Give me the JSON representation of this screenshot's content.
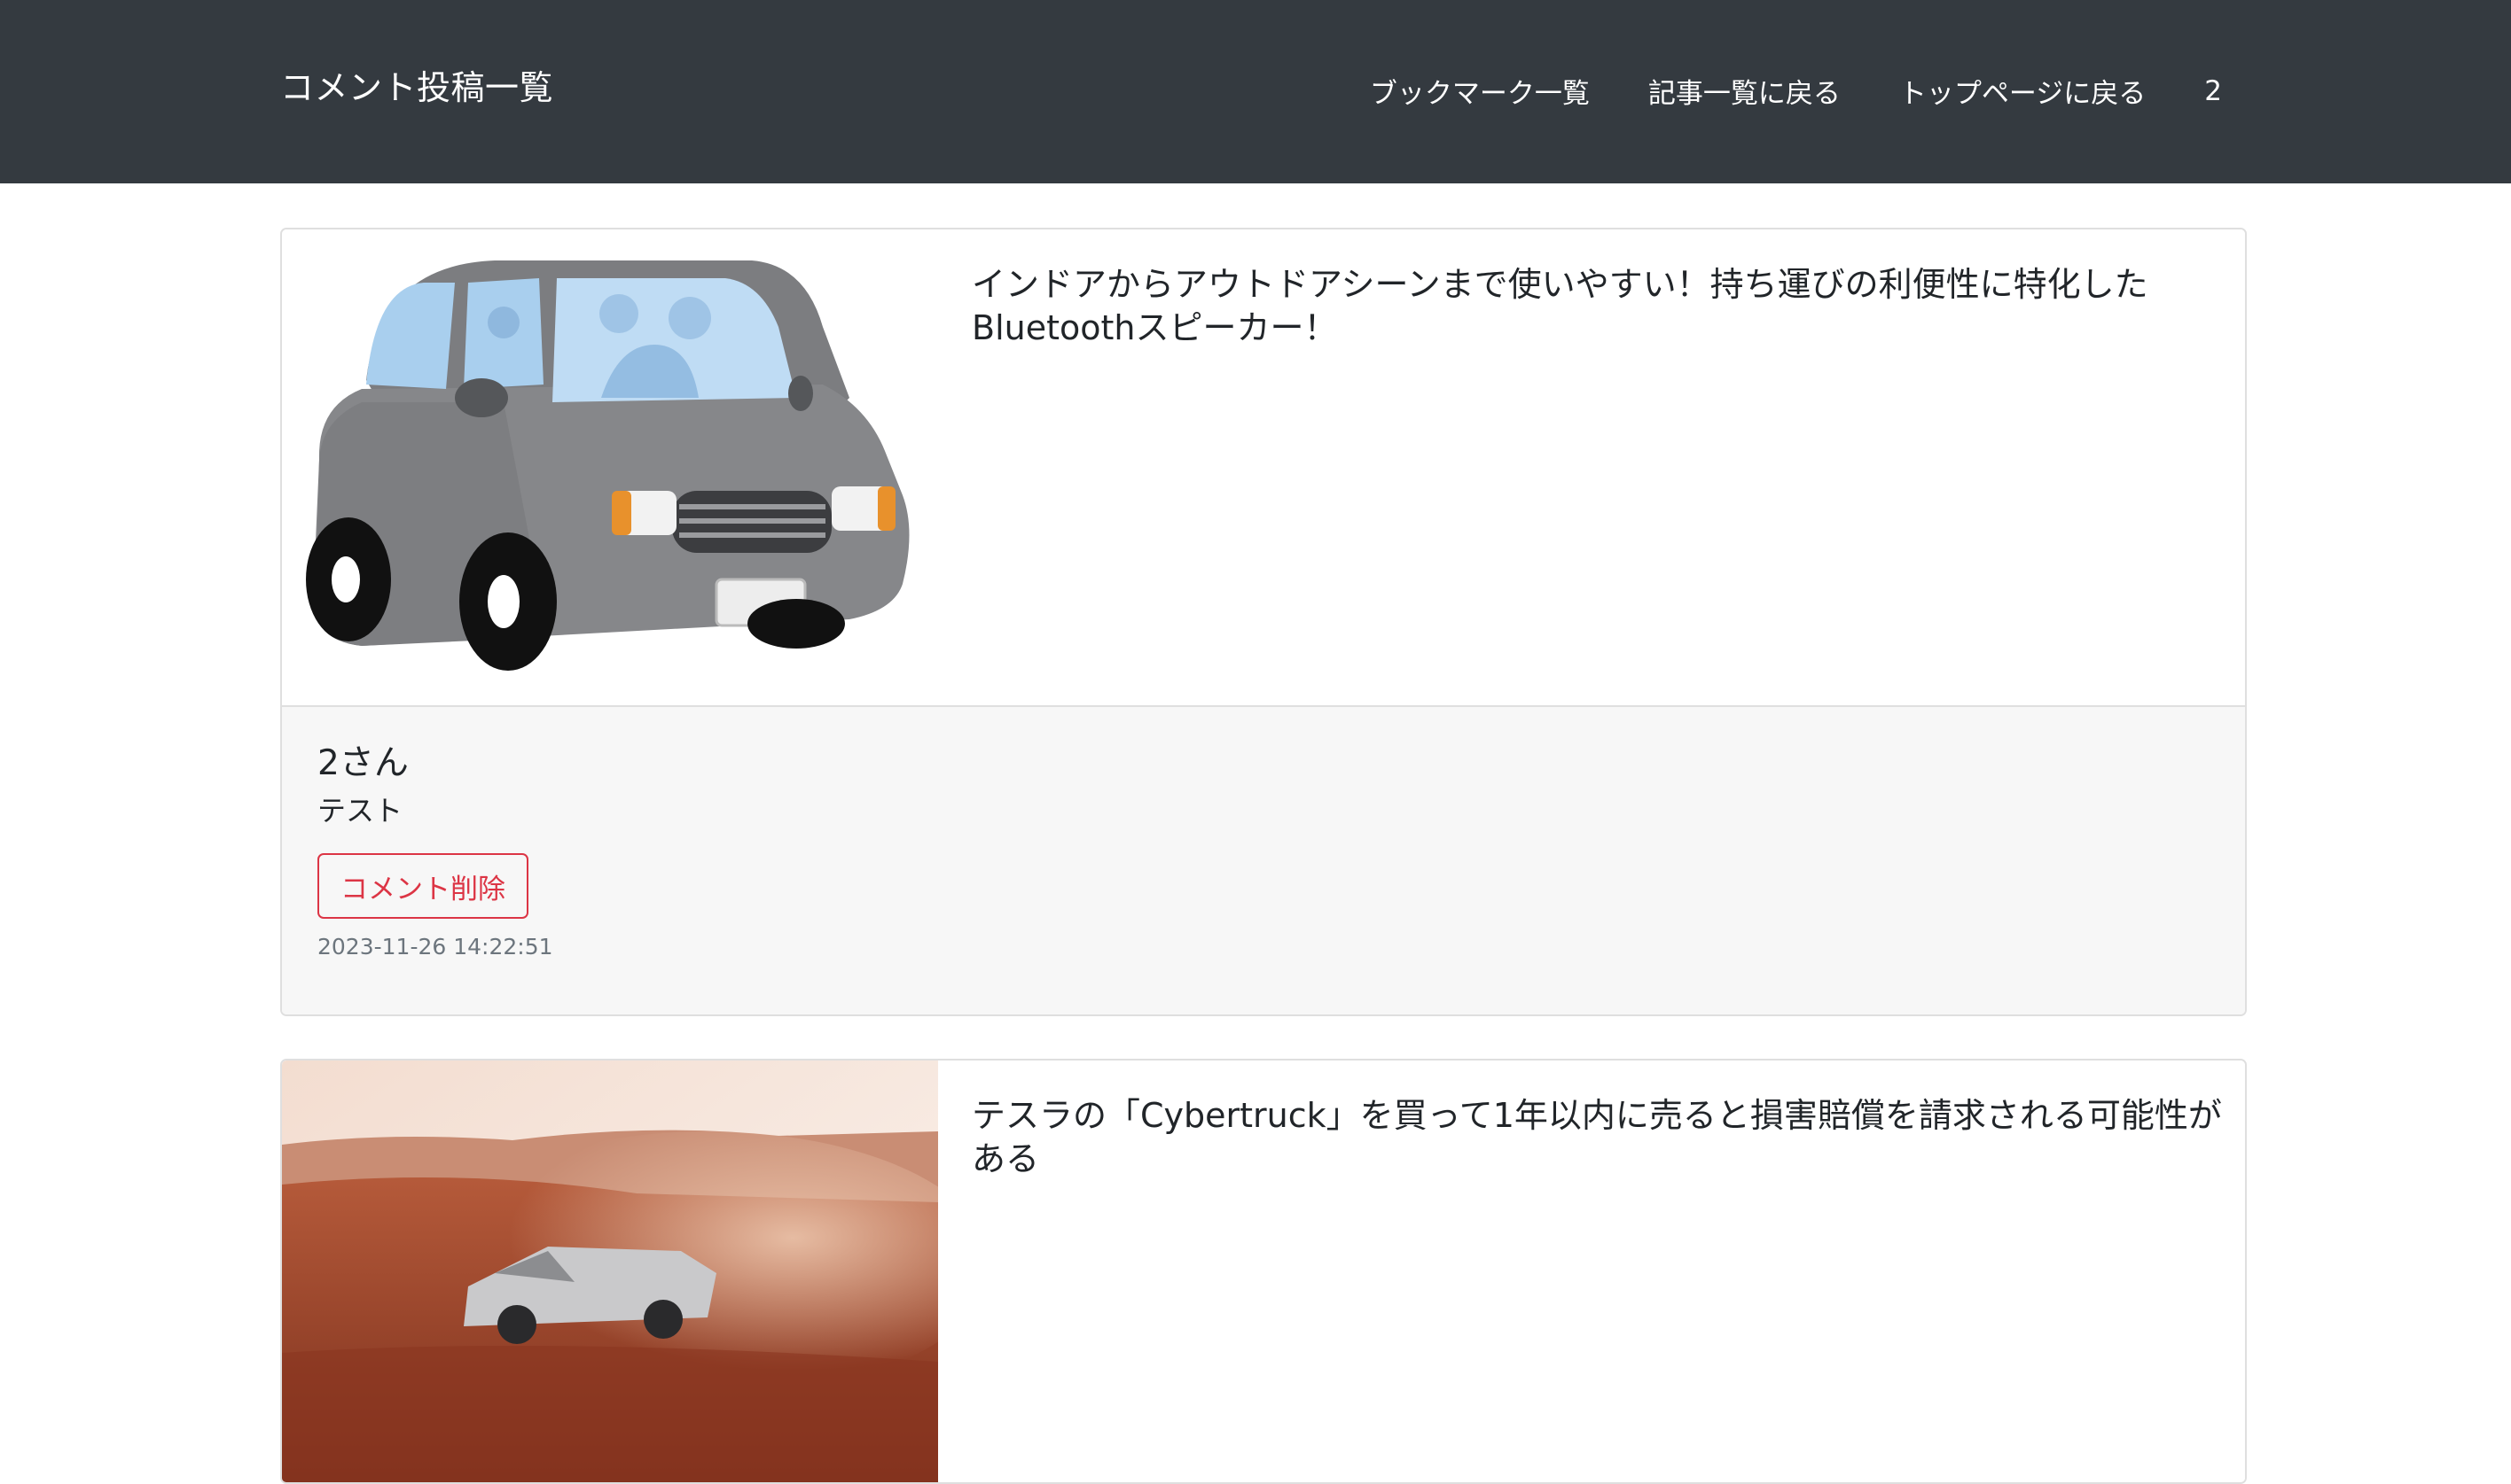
{
  "navbar": {
    "brand": "コメント投稿一覧",
    "links": [
      {
        "label": "ブックマーク一覧"
      },
      {
        "label": "記事一覧に戻る"
      },
      {
        "label": "トップページに戻る"
      },
      {
        "label": "2"
      }
    ]
  },
  "comments": [
    {
      "article_title": "インドアからアウトドアシーンまで使いやすい！持ち運びの利便性に特化したBluetoothスピーカー！",
      "author": "2さん",
      "text": "テスト",
      "delete_label": "コメント削除",
      "timestamp": "2023-11-26 14:22:51"
    },
    {
      "article_title": "テスラの「Cybertruck」を買って1年以内に売ると損害賠償を請求される可能性がある"
    }
  ],
  "colors": {
    "navbar_bg": "#343a40",
    "danger": "#dc3545",
    "footer_bg": "#f7f7f7"
  }
}
